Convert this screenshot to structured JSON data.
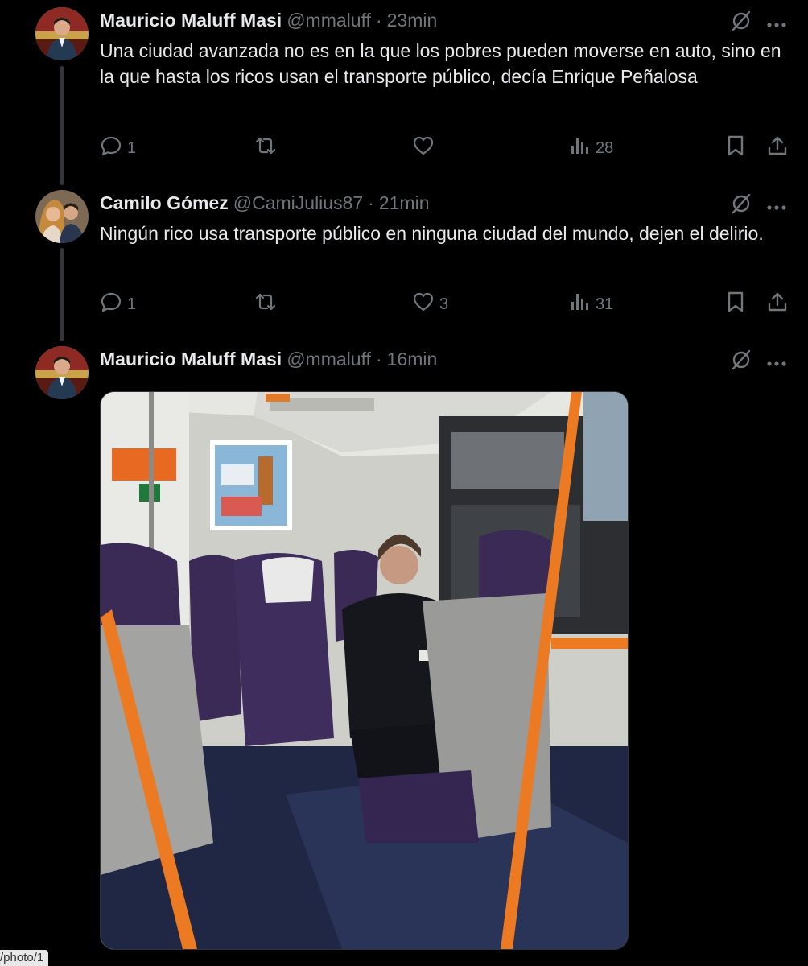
{
  "tweets": [
    {
      "name": "Mauricio Maluff Masi",
      "handle": "@mmaluff",
      "separator": "·",
      "time": "23min",
      "text": "Una ciudad avanzada no es en la que los pobres pueden moverse en auto, sino en la que hasta los ricos usan el transporte público, decía Enrique Peñalosa",
      "replies": "1",
      "reposts": "",
      "likes": "",
      "views": "28"
    },
    {
      "name": "Camilo Gómez",
      "handle": "@CamiJulius87",
      "separator": "·",
      "time": "21min",
      "text": "Ningún rico usa transporte público en ninguna ciudad del mundo, dejen el delirio.",
      "replies": "1",
      "reposts": "",
      "likes": "3",
      "views": "31"
    },
    {
      "name": "Mauricio Maluff Masi",
      "handle": "@mmaluff",
      "separator": "·",
      "time": "16min"
    }
  ],
  "status_url": "/photo/1",
  "icons": {
    "reply": "reply-icon",
    "repost": "repost-icon",
    "like": "heart-icon",
    "views": "views-icon",
    "bookmark": "bookmark-icon",
    "share": "share-icon",
    "grok": "grok-icon",
    "more": "more-icon"
  },
  "colors": {
    "background": "#000000",
    "text": "#e7e9ea",
    "muted": "#71767b",
    "thread_line": "#333639"
  }
}
